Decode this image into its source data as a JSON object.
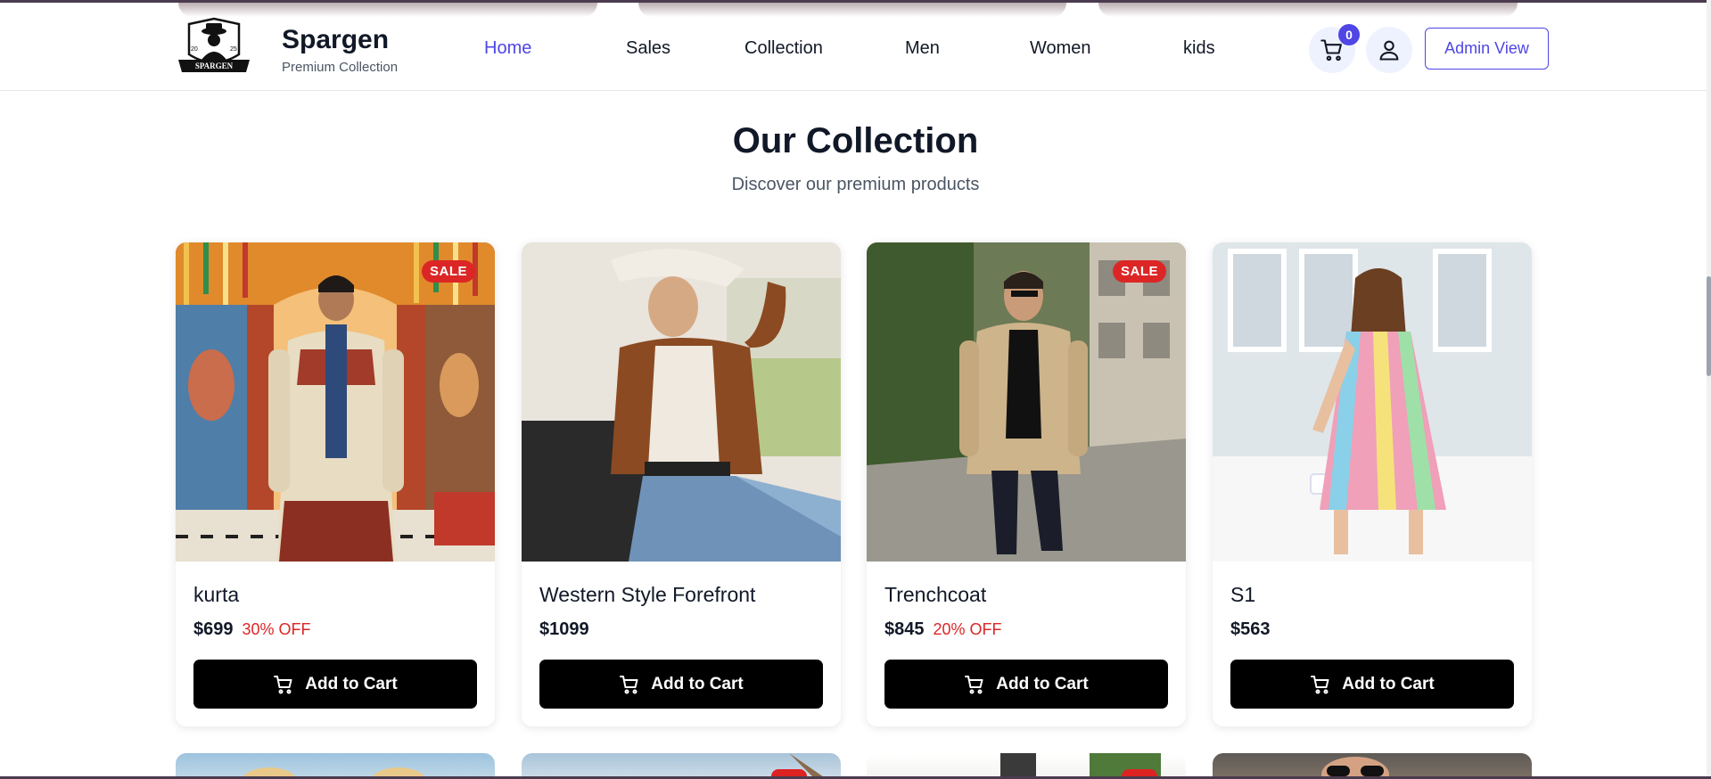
{
  "header": {
    "brand_name": "Spargen",
    "brand_tagline": "Premium Collection",
    "logo_text": "SPARGEN",
    "logo_year_left": "20",
    "logo_year_right": "25",
    "nav_items": [
      {
        "label": "Home",
        "active": true
      },
      {
        "label": "Sales",
        "active": false
      },
      {
        "label": "Collection",
        "active": false
      },
      {
        "label": "Men",
        "active": false
      },
      {
        "label": "Women",
        "active": false
      },
      {
        "label": "kids",
        "active": false
      }
    ],
    "cart_count": "0",
    "admin_label": "Admin View",
    "icons": {
      "cart": "cart-icon",
      "user": "user-icon"
    }
  },
  "collection": {
    "title": "Our Collection",
    "subtitle": "Discover our premium products",
    "sale_label": "SALE",
    "add_to_cart_label": "Add to Cart",
    "products": [
      {
        "name": "kurta",
        "price": "$699",
        "discount": "30% OFF",
        "on_sale": true
      },
      {
        "name": "Western Style Forefront",
        "price": "$1099",
        "discount": "",
        "on_sale": false
      },
      {
        "name": "Trenchcoat",
        "price": "$845",
        "discount": "20% OFF",
        "on_sale": true
      },
      {
        "name": "S1",
        "price": "$563",
        "discount": "",
        "on_sale": false
      }
    ]
  },
  "colors": {
    "accent": "#4f46e5",
    "sale": "#dc2626",
    "button": "#000000",
    "text": "#111827",
    "muted": "#4b5563"
  }
}
